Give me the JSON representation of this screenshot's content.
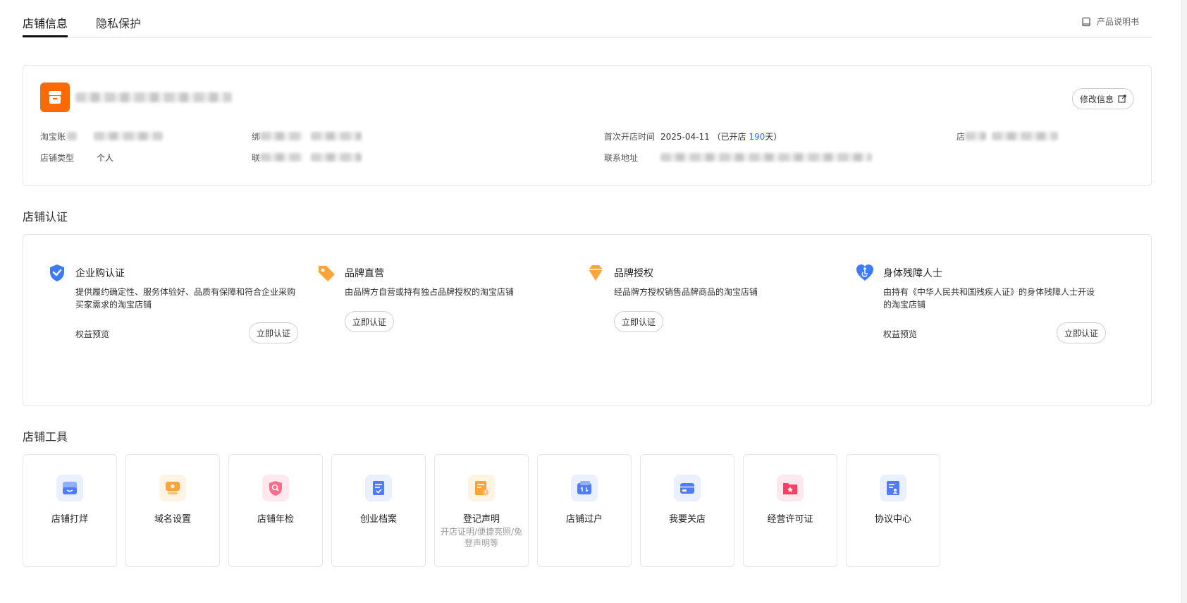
{
  "tabs": [
    {
      "label": "店铺信息",
      "active": true
    },
    {
      "label": "隐私保护",
      "active": false
    }
  ],
  "manual_label": "产品说明书",
  "shop": {
    "edit_label": "修改信息",
    "fields": {
      "account_label": "淘宝账",
      "bind_label": "绑",
      "first_open_label": "首次开店时间",
      "first_open_value_prefix": "2025-04-11 （已开店 ",
      "first_open_days": "190",
      "first_open_value_suffix": "天）",
      "store_label": "店",
      "type_label": "店铺类型",
      "type_value": "个人",
      "contact_label": "联",
      "address_label": "联系地址"
    }
  },
  "certification": {
    "title": "店铺认证",
    "items": [
      {
        "title": "企业购认证",
        "desc": "提供履约确定性、服务体验好、品质有保障和符合企业采购买家需求的淘宝店铺",
        "preview": "权益预览",
        "button": "立即认证"
      },
      {
        "title": "品牌直营",
        "desc": "由品牌方自营或持有独占品牌授权的淘宝店铺",
        "button": "立即认证"
      },
      {
        "title": "品牌授权",
        "desc": "经品牌方授权销售品牌商品的淘宝店铺",
        "button": "立即认证"
      },
      {
        "title": "身体残障人士",
        "desc": "由持有《中华人民共和国残疾人证》的身体残障人士开设的淘宝店铺",
        "preview": "权益预览",
        "button": "立即认证"
      }
    ]
  },
  "tools": {
    "title": "店铺工具",
    "items": [
      {
        "label": "店铺打烊",
        "icon": "store-close-icon",
        "color": "#4f7cff"
      },
      {
        "label": "域名设置",
        "icon": "domain-settings-icon",
        "color": "#ff9a1f"
      },
      {
        "label": "店铺年检",
        "icon": "annual-check-icon",
        "color": "#ff5c7a"
      },
      {
        "label": "创业档案",
        "icon": "startup-archive-icon",
        "color": "#4f7cff"
      },
      {
        "label": "登记声明",
        "sub": "开店证明/便捷亮照/免登声明等",
        "icon": "registration-icon",
        "color": "#ff9a1f"
      },
      {
        "label": "店铺过户",
        "icon": "store-transfer-icon",
        "color": "#4f7cff"
      },
      {
        "label": "我要关店",
        "icon": "close-store-icon",
        "color": "#4f7cff"
      },
      {
        "label": "经营许可证",
        "icon": "license-icon",
        "color": "#ff3f66"
      },
      {
        "label": "协议中心",
        "icon": "agreement-icon",
        "color": "#4f7cff"
      }
    ]
  }
}
